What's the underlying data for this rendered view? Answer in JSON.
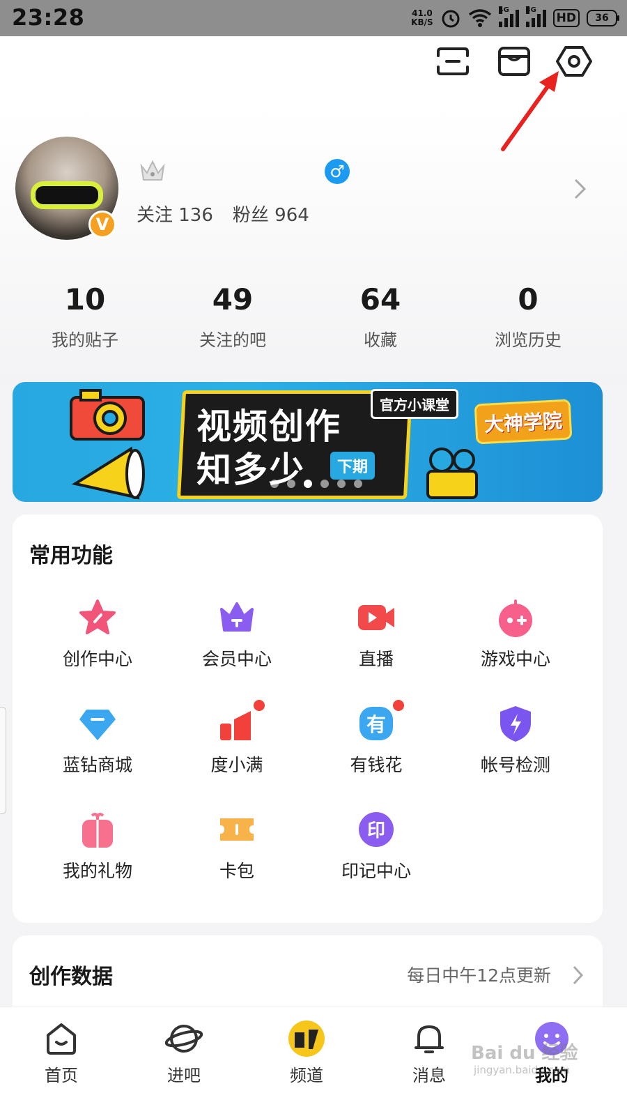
{
  "status_bar": {
    "time": "23:28",
    "net_speed": "41.0",
    "net_unit": "KB/S",
    "sig1_gen": "4G",
    "sig2_gen": "3G",
    "hd": "HD",
    "battery": "36"
  },
  "profile": {
    "follow_label": "关注 136",
    "fans_label": "粉丝 964",
    "gender_symbol": "♂",
    "verified": "V"
  },
  "stats": [
    {
      "value": "10",
      "label": "我的贴子"
    },
    {
      "value": "49",
      "label": "关注的吧"
    },
    {
      "value": "64",
      "label": "收藏"
    },
    {
      "value": "0",
      "label": "浏览历史"
    }
  ],
  "banner": {
    "line1": "视频创作",
    "line2": "知多少",
    "tag_top": "官方小课堂",
    "tag_bottom": "下期",
    "logo": "大神学院",
    "page_count": 6,
    "active_page": 3
  },
  "functions": {
    "title": "常用功能",
    "items": [
      {
        "label": "创作中心",
        "icon": "star-pen-icon",
        "color": "#f2557a"
      },
      {
        "label": "会员中心",
        "icon": "crown-icon",
        "color": "#8a5cf0"
      },
      {
        "label": "直播",
        "icon": "video-camera-icon",
        "color": "#f24a4a"
      },
      {
        "label": "游戏中心",
        "icon": "gamepad-icon",
        "color": "#f7608a"
      },
      {
        "label": "蓝钻商城",
        "icon": "diamond-icon",
        "color": "#3aa7f0"
      },
      {
        "label": "度小满",
        "icon": "bar-chart-icon",
        "color": "#f2403a"
      },
      {
        "label": "有钱花",
        "icon": "money-icon",
        "color": "#3aa7f0"
      },
      {
        "label": "帐号检测",
        "icon": "shield-bolt-icon",
        "color": "#7a55f0"
      },
      {
        "label": "我的礼物",
        "icon": "gift-icon",
        "color": "#f7708e"
      },
      {
        "label": "卡包",
        "icon": "ticket-icon",
        "color": "#f7b24a"
      },
      {
        "label": "印记中心",
        "icon": "seal-icon",
        "color": "#8a5cf0"
      }
    ],
    "money_glyph": "有",
    "seal_glyph": "印"
  },
  "creation_data": {
    "title": "创作数据",
    "note": "每日中午12点更新"
  },
  "nav": [
    {
      "label": "首页",
      "icon": "home-icon"
    },
    {
      "label": "进吧",
      "icon": "planet-icon"
    },
    {
      "label": "频道",
      "icon": "channel-icon"
    },
    {
      "label": "消息",
      "icon": "bell-icon"
    },
    {
      "label": "我的",
      "icon": "smiley-icon"
    }
  ],
  "watermark": {
    "main": "Bai du 经验",
    "sub": "jingyan.baidu.com"
  }
}
